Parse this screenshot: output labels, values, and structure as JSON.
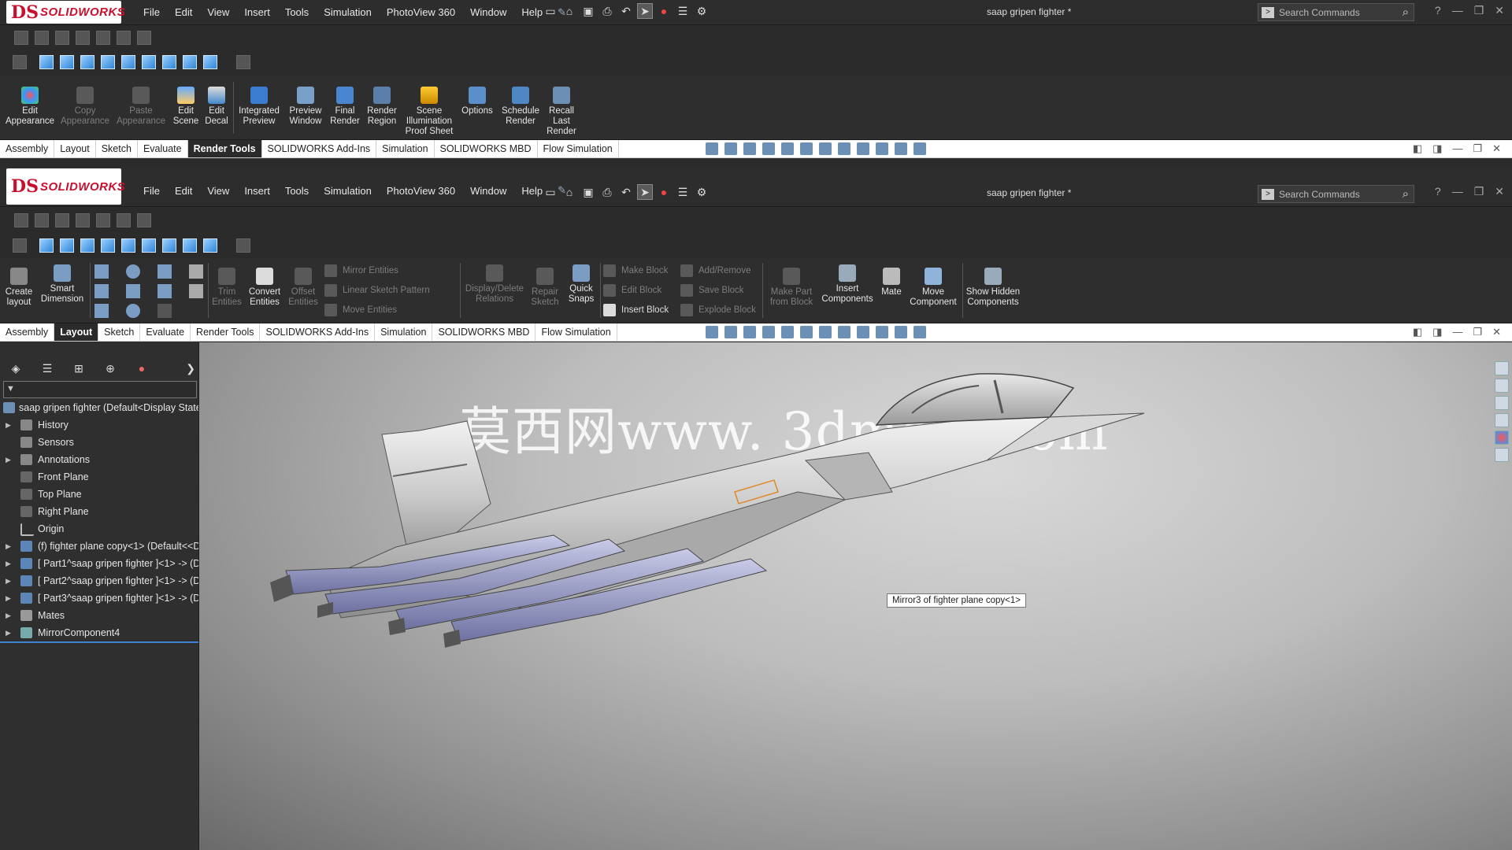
{
  "app": {
    "logo": "SOLIDWORKS",
    "document_title": "saap gripen fighter *"
  },
  "menu": [
    "File",
    "Edit",
    "View",
    "Insert",
    "Tools",
    "Simulation",
    "PhotoView 360",
    "Window",
    "Help"
  ],
  "search": {
    "placeholder": "Search Commands"
  },
  "render_ribbon": {
    "buttons": [
      "Edit Appearance",
      "Copy Appearance",
      "Paste Appearance",
      "Edit Scene",
      "Edit Decal",
      "Integrated Preview",
      "Preview Window",
      "Final Render",
      "Render Region",
      "Scene Illumination Proof Sheet",
      "Options",
      "Schedule Render",
      "Recall Last Render"
    ]
  },
  "tabs_top": {
    "items": [
      "Assembly",
      "Layout",
      "Sketch",
      "Evaluate",
      "Render Tools",
      "SOLIDWORKS Add-Ins",
      "Simulation",
      "SOLIDWORKS MBD",
      "Flow Simulation"
    ],
    "active": "Render Tools"
  },
  "layout_ribbon": {
    "create_layout": "Create layout",
    "smart_dimension": "Smart Dimension",
    "trim_entities": "Trim Entities",
    "convert_entities": "Convert Entities",
    "offset_entities": "Offset Entities",
    "mirror_entities": "Mirror Entities",
    "linear_sketch_pattern": "Linear Sketch Pattern",
    "move_entities": "Move Entities",
    "display_delete_relations": "Display/Delete Relations",
    "repair_sketch": "Repair Sketch",
    "quick_snaps": "Quick Snaps",
    "make_block": "Make Block",
    "edit_block": "Edit Block",
    "insert_block": "Insert Block",
    "add_remove": "Add/Remove",
    "save_block": "Save Block",
    "explode_block": "Explode Block",
    "make_part_from_block": "Make Part from Block",
    "insert_components": "Insert Components",
    "mate": "Mate",
    "move_component": "Move Component",
    "show_hidden_components": "Show Hidden Components"
  },
  "tabs_bottom": {
    "items": [
      "Assembly",
      "Layout",
      "Sketch",
      "Evaluate",
      "Render Tools",
      "SOLIDWORKS Add-Ins",
      "Simulation",
      "SOLIDWORKS MBD",
      "Flow Simulation"
    ],
    "active": "Layout"
  },
  "tree": {
    "root": "saap gripen fighter  (Default<Display State-",
    "nodes": [
      {
        "label": "History",
        "expandable": true
      },
      {
        "label": "Sensors",
        "expandable": false
      },
      {
        "label": "Annotations",
        "expandable": true
      },
      {
        "label": "Front Plane",
        "expandable": false
      },
      {
        "label": "Top Plane",
        "expandable": false
      },
      {
        "label": "Right Plane",
        "expandable": false
      },
      {
        "label": "Origin",
        "expandable": false
      },
      {
        "label": "(f) fighter plane copy<1> (Default<<D",
        "expandable": true
      },
      {
        "label": "[ Part1^saap gripen fighter ]<1> -> (D",
        "expandable": true
      },
      {
        "label": "[ Part2^saap gripen fighter ]<1> -> (D",
        "expandable": true
      },
      {
        "label": "[ Part3^saap gripen fighter ]<1> -> (D",
        "expandable": true
      },
      {
        "label": "Mates",
        "expandable": true
      },
      {
        "label": "MirrorComponent4",
        "expandable": true
      }
    ]
  },
  "viewport": {
    "watermark": "莫西网www. 3dmox. com",
    "tooltip": "Mirror3 of fighter plane copy<1>"
  },
  "colors": {
    "accent": "#3d82d6",
    "brand": "#c8102e",
    "ui_dark": "#2b2b2b"
  }
}
